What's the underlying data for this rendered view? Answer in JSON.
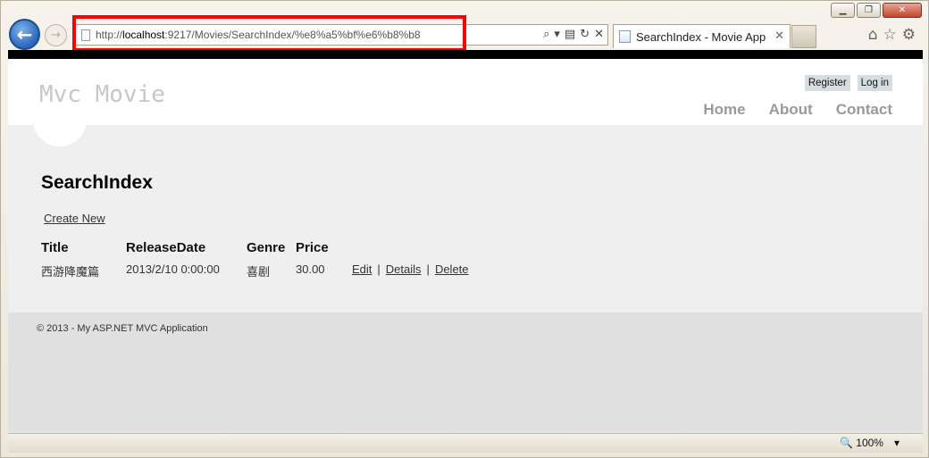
{
  "browser": {
    "url_prefix": "http://",
    "url_host": "localhost",
    "url_rest": ":9217/Movies/SearchIndex/%e8%a5%bf%e6%b8%b8",
    "tab_title": "SearchIndex - Movie App",
    "zoom": "100%"
  },
  "site": {
    "title": "Mvc Movie",
    "register": "Register",
    "login": "Log in",
    "menu": [
      "Home",
      "About",
      "Contact"
    ]
  },
  "page": {
    "heading": "SearchIndex",
    "create_new": "Create New",
    "columns": [
      "Title",
      "ReleaseDate",
      "Genre",
      "Price"
    ],
    "rows": [
      {
        "title": "西游降魔篇",
        "release_date": "2013/2/10 0:00:00",
        "genre": "喜剧",
        "price": "30.00",
        "actions": [
          "Edit",
          "Details",
          "Delete"
        ]
      }
    ]
  },
  "footer": {
    "copyright": "© 2013 - My ASP.NET MVC Application"
  }
}
